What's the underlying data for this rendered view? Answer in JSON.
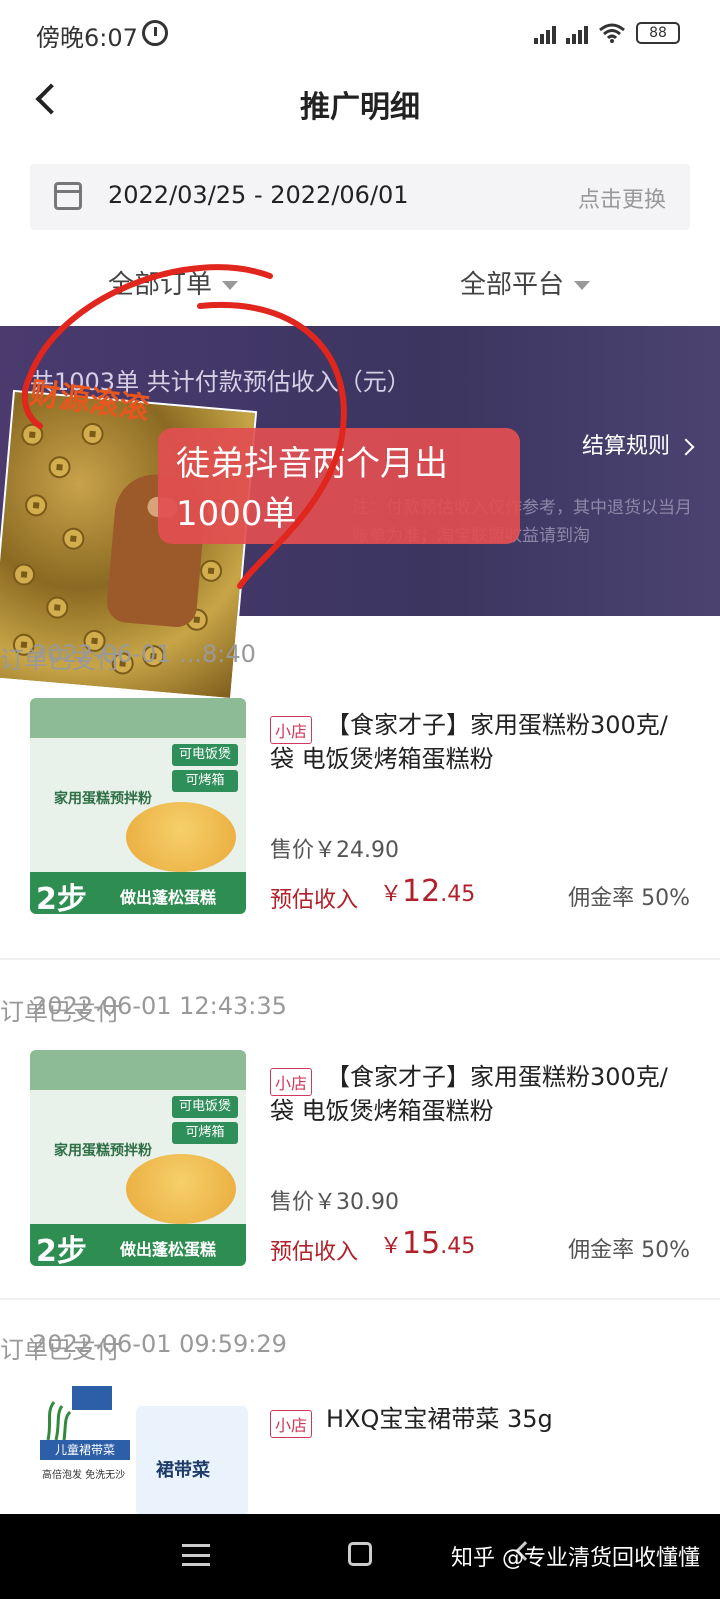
{
  "status_bar": {
    "time": "傍晚6:07",
    "battery": "88"
  },
  "header": {
    "title": "推广明细"
  },
  "date_bar": {
    "range": "2022/03/25 - 2022/06/01",
    "change_label": "点击更换"
  },
  "filters": {
    "order_filter": "全部订单",
    "platform_filter": "全部平台"
  },
  "banner": {
    "summary": "共1003单 共计付款预估收入（元）",
    "rule_label": "结算规则",
    "note": "注：付款预估收入仅作参考，其中退货以当月账单为准；淘宝联盟收益请到淘"
  },
  "sticker": {
    "text": "财源滚滚"
  },
  "callout": {
    "line1": "徒弟抖音两个月出",
    "line2": "1000单"
  },
  "orders": [
    {
      "time": "2022-06-01 ...8:40",
      "status": "订单已支付",
      "tag": "小店",
      "name": "【食家才子】家用蛋糕粉300克/袋 电饭煲烤箱蛋糕粉",
      "price": "售价￥24.90",
      "income_label": "预估收入",
      "income_symbol": "￥",
      "income_int": "12",
      "income_dec": ".45",
      "rate": "佣金率 50%"
    },
    {
      "time": "2022-06-01 12:43:35",
      "status": "订单已支付",
      "tag": "小店",
      "name": "【食家才子】家用蛋糕粉300克/袋 电饭煲烤箱蛋糕粉",
      "price": "售价￥30.90",
      "income_label": "预估收入",
      "income_symbol": "￥",
      "income_int": "15",
      "income_dec": ".45",
      "rate": "佣金率 50%"
    },
    {
      "time": "2022-06-01 09:59:29",
      "status": "订单已支付",
      "tag": "小店",
      "name": "HXQ宝宝裙带菜 35g"
    }
  ],
  "product_art": {
    "cake_tag1": "可电饭煲",
    "cake_tag2": "可烤箱",
    "cake_title": "家用蛋糕预拌粉",
    "cake_step": "2步",
    "cake_slogan": "做出蓬松蛋糕",
    "sea_kid": "儿童裙带菜",
    "sea_sub": "高倍泡发 免洗无沙",
    "sea_bag": "裙带菜"
  },
  "watermark": "知乎 @专业清货回收懂懂"
}
